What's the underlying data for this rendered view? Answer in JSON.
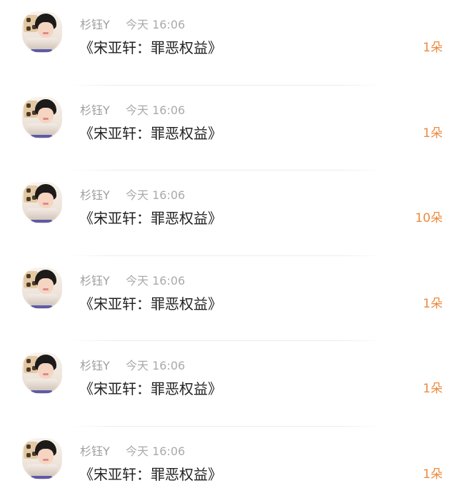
{
  "colors": {
    "accent": "#ee8a3e",
    "name_text": "#9e9e9e",
    "time_text": "#aaaaaa",
    "message_text": "#222222",
    "divider": "#ececec"
  },
  "rows": [
    {
      "name": "杉钰Y",
      "time": "今天 16:06",
      "message": "《宋亚轩：罪恶权益》",
      "count": "1朵"
    },
    {
      "name": "杉钰Y",
      "time": "今天 16:06",
      "message": "《宋亚轩：罪恶权益》",
      "count": "1朵"
    },
    {
      "name": "杉钰Y",
      "time": "今天 16:06",
      "message": "《宋亚轩：罪恶权益》",
      "count": "10朵"
    },
    {
      "name": "杉钰Y",
      "time": "今天 16:06",
      "message": "《宋亚轩：罪恶权益》",
      "count": "1朵"
    },
    {
      "name": "杉钰Y",
      "time": "今天 16:06",
      "message": "《宋亚轩：罪恶权益》",
      "count": "1朵"
    },
    {
      "name": "杉钰Y",
      "time": "今天 16:06",
      "message": "《宋亚轩：罪恶权益》",
      "count": "1朵"
    }
  ]
}
